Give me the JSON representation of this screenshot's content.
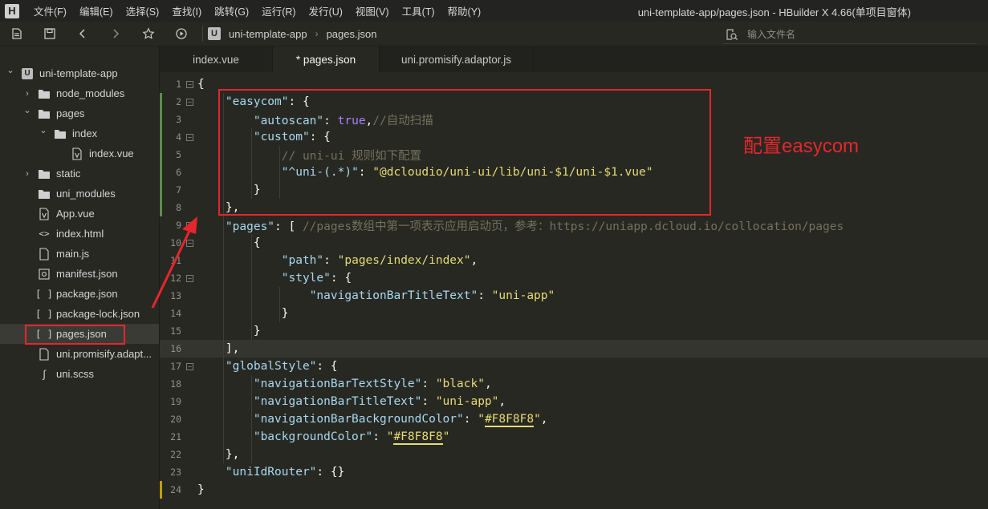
{
  "menubar": {
    "logo": "H",
    "items": [
      "文件(F)",
      "编辑(E)",
      "选择(S)",
      "查找(I)",
      "跳转(G)",
      "运行(R)",
      "发行(U)",
      "视图(V)",
      "工具(T)",
      "帮助(Y)"
    ],
    "window_title": "uni-template-app/pages.json - HBuilder X 4.66(单项目窗体)"
  },
  "toolbar": {
    "breadcrumb_logo": "U",
    "breadcrumb": [
      "uni-template-app",
      "pages.json"
    ],
    "search_placeholder": "输入文件名"
  },
  "sidebar": {
    "items": [
      {
        "label": "uni-template-app",
        "icon": "project-icon",
        "chevron": "expanded"
      },
      {
        "label": "node_modules",
        "icon": "folder-icon",
        "chevron": "collapsed"
      },
      {
        "label": "pages",
        "icon": "folder-icon",
        "chevron": "expanded"
      },
      {
        "label": "index",
        "icon": "folder-icon",
        "chevron": "expanded"
      },
      {
        "label": "index.vue",
        "icon": "vue-file-icon",
        "chevron": "none"
      },
      {
        "label": "static",
        "icon": "folder-icon",
        "chevron": "collapsed"
      },
      {
        "label": "uni_modules",
        "icon": "folder-icon",
        "chevron": "none"
      },
      {
        "label": "App.vue",
        "icon": "vue-file-icon",
        "chevron": "none"
      },
      {
        "label": "index.html",
        "icon": "html-file-icon",
        "chevron": "none"
      },
      {
        "label": "main.js",
        "icon": "file-icon",
        "chevron": "none"
      },
      {
        "label": "manifest.json",
        "icon": "manifest-icon",
        "chevron": "none"
      },
      {
        "label": "package.json",
        "icon": "json-file-icon",
        "chevron": "none"
      },
      {
        "label": "package-lock.json",
        "icon": "json-file-icon",
        "chevron": "none"
      },
      {
        "label": "pages.json",
        "icon": "json-file-icon",
        "chevron": "none",
        "selected": true
      },
      {
        "label": "uni.promisify.adapt...",
        "icon": "file-icon",
        "chevron": "none"
      },
      {
        "label": "uni.scss",
        "icon": "scss-file-icon",
        "chevron": "none"
      }
    ]
  },
  "tabs": [
    {
      "label": "index.vue",
      "active": false
    },
    {
      "label": "* pages.json",
      "active": true
    },
    {
      "label": "uni.promisify.adaptor.js",
      "active": false
    }
  ],
  "annotation": "配置easycom",
  "editor": {
    "current_line": 16,
    "lines": [
      {
        "n": "1",
        "fold": true,
        "tokens": [
          [
            "p",
            "{"
          ]
        ]
      },
      {
        "n": "2",
        "fold": true,
        "tokens": [
          [
            "p",
            "    "
          ],
          [
            "k",
            "\"easycom\""
          ],
          [
            "p",
            ": {"
          ]
        ]
      },
      {
        "n": "3",
        "fold": false,
        "tokens": [
          [
            "p",
            "        "
          ],
          [
            "k",
            "\"autoscan\""
          ],
          [
            "p",
            ": "
          ],
          [
            "b",
            "true"
          ],
          [
            "p",
            ","
          ],
          [
            "c",
            "//自动扫描"
          ]
        ]
      },
      {
        "n": "4",
        "fold": true,
        "tokens": [
          [
            "p",
            "        "
          ],
          [
            "k",
            "\"custom\""
          ],
          [
            "p",
            ": {"
          ]
        ]
      },
      {
        "n": "5",
        "fold": false,
        "tokens": [
          [
            "p",
            "            "
          ],
          [
            "c",
            "// uni-ui 规则如下配置"
          ]
        ]
      },
      {
        "n": "6",
        "fold": false,
        "tokens": [
          [
            "p",
            "            "
          ],
          [
            "k",
            "\"^uni-(.*)\""
          ],
          [
            "p",
            ": "
          ],
          [
            "s",
            "\"@dcloudio/uni-ui/lib/uni-$1/uni-$1.vue\""
          ]
        ]
      },
      {
        "n": "7",
        "fold": false,
        "tokens": [
          [
            "p",
            "        }"
          ]
        ]
      },
      {
        "n": "8",
        "fold": false,
        "tokens": [
          [
            "p",
            "    },"
          ]
        ]
      },
      {
        "n": "9",
        "fold": true,
        "tokens": [
          [
            "p",
            "    "
          ],
          [
            "k",
            "\"pages\""
          ],
          [
            "p",
            ": [ "
          ],
          [
            "c",
            "//pages数组中第一项表示应用启动页，参考：https://uniapp.dcloud.io/collocation/pages"
          ]
        ]
      },
      {
        "n": "10",
        "fold": true,
        "tokens": [
          [
            "p",
            "        {"
          ]
        ]
      },
      {
        "n": "11",
        "fold": false,
        "tokens": [
          [
            "p",
            "            "
          ],
          [
            "k",
            "\"path\""
          ],
          [
            "p",
            ": "
          ],
          [
            "s",
            "\"pages/index/index\""
          ],
          [
            "p",
            ","
          ]
        ]
      },
      {
        "n": "12",
        "fold": true,
        "tokens": [
          [
            "p",
            "            "
          ],
          [
            "k",
            "\"style\""
          ],
          [
            "p",
            ": {"
          ]
        ]
      },
      {
        "n": "13",
        "fold": false,
        "tokens": [
          [
            "p",
            "                "
          ],
          [
            "k",
            "\"navigationBarTitleText\""
          ],
          [
            "p",
            ": "
          ],
          [
            "s",
            "\"uni-app\""
          ]
        ]
      },
      {
        "n": "14",
        "fold": false,
        "tokens": [
          [
            "p",
            "            }"
          ]
        ]
      },
      {
        "n": "15",
        "fold": false,
        "tokens": [
          [
            "p",
            "        }"
          ]
        ]
      },
      {
        "n": "16",
        "fold": false,
        "tokens": [
          [
            "p",
            "    ],"
          ]
        ]
      },
      {
        "n": "17",
        "fold": true,
        "tokens": [
          [
            "p",
            "    "
          ],
          [
            "k",
            "\"globalStyle\""
          ],
          [
            "p",
            ": {"
          ]
        ]
      },
      {
        "n": "18",
        "fold": false,
        "tokens": [
          [
            "p",
            "        "
          ],
          [
            "k",
            "\"navigationBarTextStyle\""
          ],
          [
            "p",
            ": "
          ],
          [
            "s",
            "\"black\""
          ],
          [
            "p",
            ","
          ]
        ]
      },
      {
        "n": "19",
        "fold": false,
        "tokens": [
          [
            "p",
            "        "
          ],
          [
            "k",
            "\"navigationBarTitleText\""
          ],
          [
            "p",
            ": "
          ],
          [
            "s",
            "\"uni-app\""
          ],
          [
            "p",
            ","
          ]
        ]
      },
      {
        "n": "20",
        "fold": false,
        "tokens": [
          [
            "p",
            "        "
          ],
          [
            "k",
            "\"navigationBarBackgroundColor\""
          ],
          [
            "p",
            ": "
          ],
          [
            "s",
            "\""
          ],
          [
            "u",
            "#F8F8F8"
          ],
          [
            "s",
            "\""
          ],
          [
            "p",
            ","
          ]
        ]
      },
      {
        "n": "21",
        "fold": false,
        "tokens": [
          [
            "p",
            "        "
          ],
          [
            "k",
            "\"backgroundColor\""
          ],
          [
            "p",
            ": "
          ],
          [
            "s",
            "\""
          ],
          [
            "u",
            "#F8F8F8"
          ],
          [
            "s",
            "\""
          ]
        ]
      },
      {
        "n": "22",
        "fold": false,
        "tokens": [
          [
            "p",
            "    },"
          ]
        ]
      },
      {
        "n": "23",
        "fold": false,
        "tokens": [
          [
            "p",
            "    "
          ],
          [
            "k",
            "\"uniIdRouter\""
          ],
          [
            "p",
            ": {}"
          ]
        ]
      },
      {
        "n": "24",
        "fold": false,
        "tokens": [
          [
            "p",
            "}"
          ]
        ]
      }
    ]
  },
  "colors": {
    "background": "#272822",
    "accent_red": "#e5262c",
    "string": "#e6db74",
    "key": "#a8d8f0",
    "comment": "#75715e",
    "boolean": "#ae81ff"
  }
}
